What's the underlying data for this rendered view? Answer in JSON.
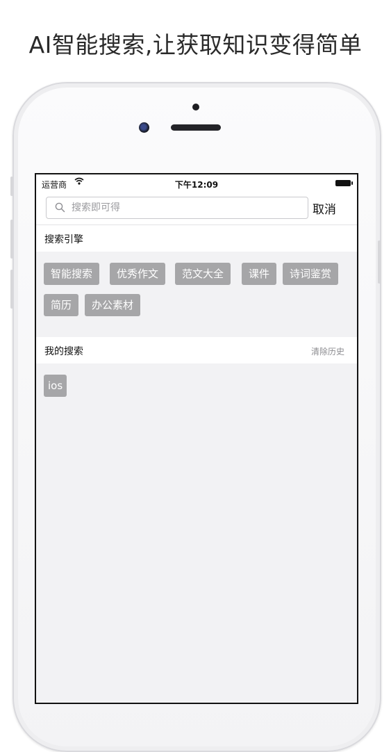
{
  "headline": "AI智能搜索,让获取知识变得简单",
  "status_bar": {
    "carrier": "运营商",
    "time": "下午12:09",
    "wifi_icon": "wifi-icon",
    "battery_icon": "battery-icon"
  },
  "search": {
    "placeholder": "搜索即可得",
    "value": "",
    "icon": "search-icon",
    "cancel_label": "取消"
  },
  "engines": {
    "title": "搜索引擎",
    "tags": [
      "智能搜索",
      "优秀作文",
      "范文大全",
      "课件",
      "诗词鉴赏",
      "简历",
      "办公素材"
    ]
  },
  "history": {
    "title": "我的搜索",
    "clear_label": "清除历史",
    "tags": [
      "ios"
    ]
  },
  "colors": {
    "tag_bg": "#a6a6a8",
    "screen_bg": "#f2f2f4",
    "section_bg": "#ffffff"
  }
}
